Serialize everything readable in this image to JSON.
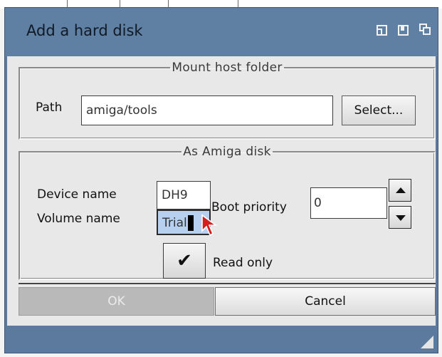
{
  "window": {
    "title": "Add a hard disk"
  },
  "mount_group": {
    "legend": "Mount host folder",
    "path_label": "Path",
    "path_value": "amiga/tools",
    "select_label": "Select..."
  },
  "amiga_group": {
    "legend": "As Amiga disk",
    "device_label": "Device name",
    "device_value": "DH9",
    "volume_label": "Volume name",
    "volume_value": "Trial",
    "boot_label": "Boot priority",
    "boot_value": "0",
    "readonly_label": "Read only",
    "readonly_checked": true
  },
  "buttons": {
    "ok_label": "OK",
    "cancel_label": "Cancel"
  },
  "colors": {
    "titlebar": "#5f7fa3",
    "client": "#e8e8e8",
    "selection": "#b8d0f0"
  }
}
